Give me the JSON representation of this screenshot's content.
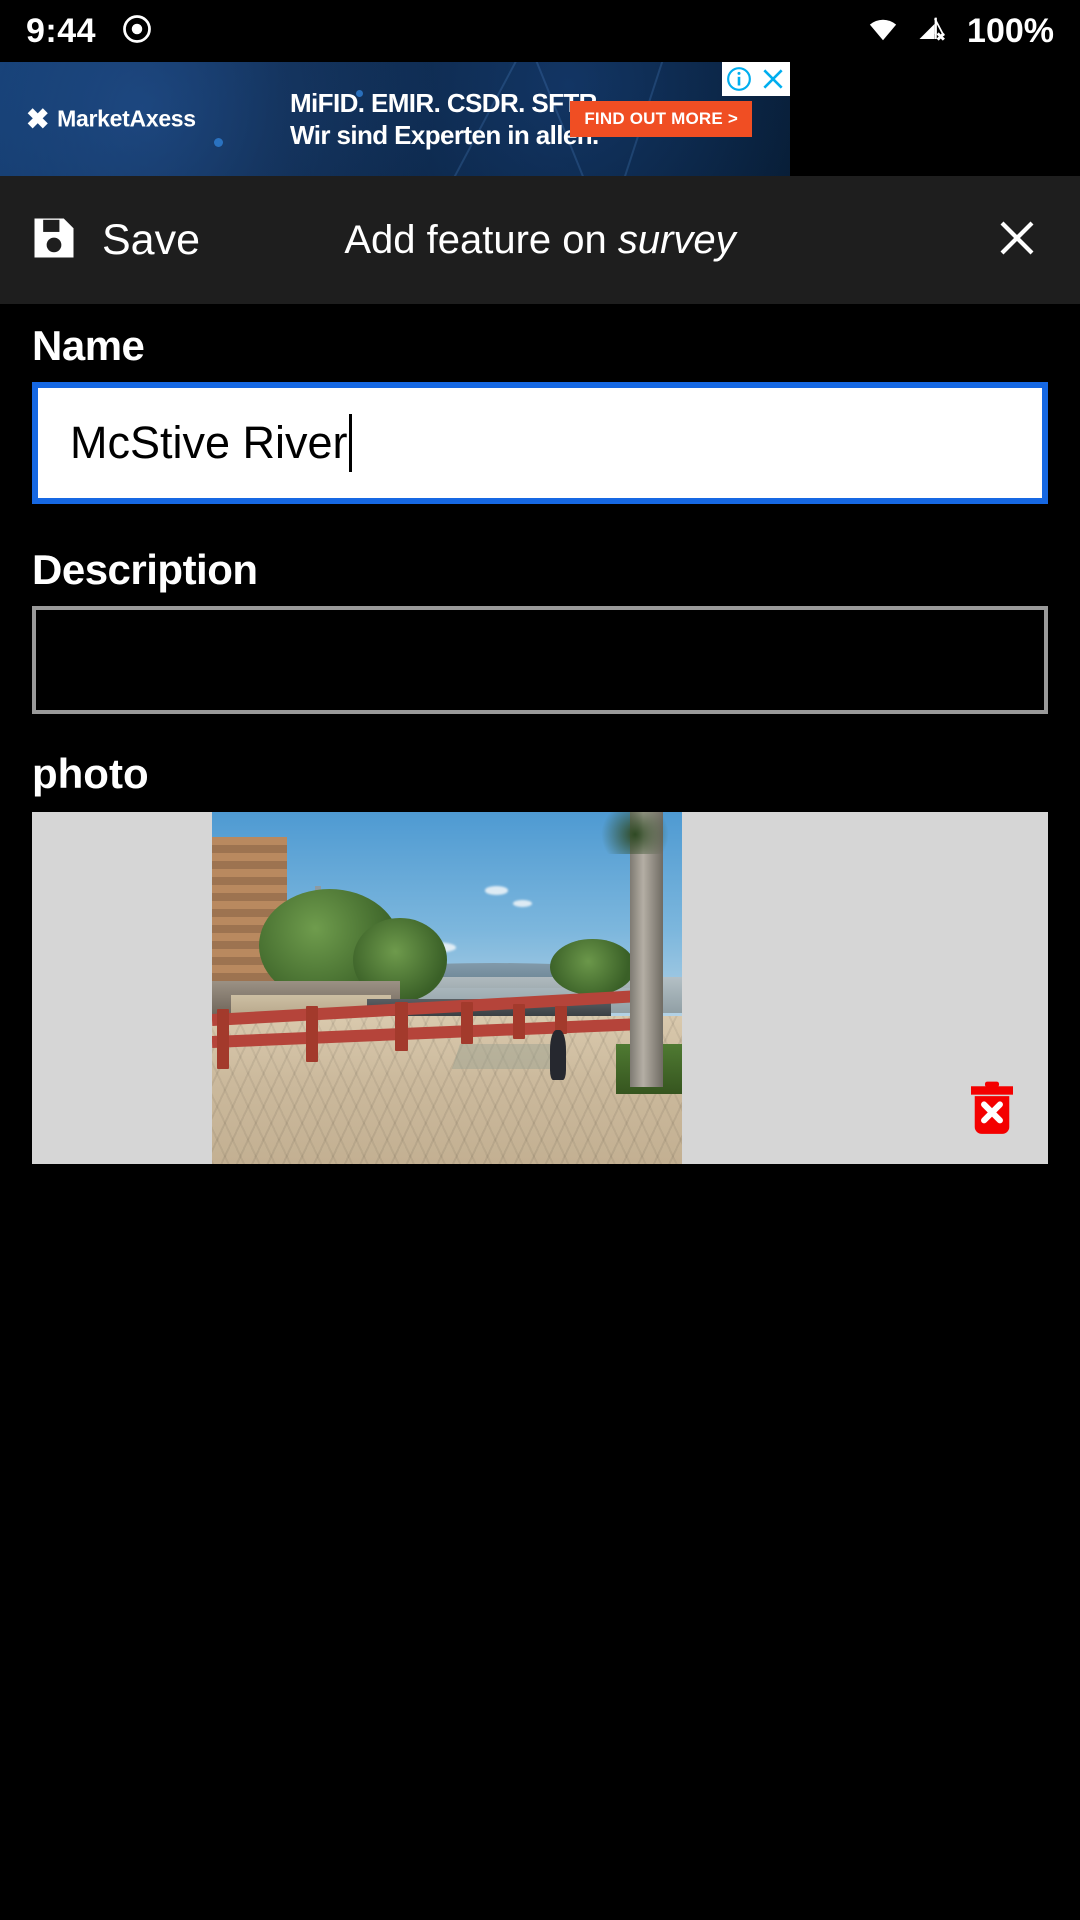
{
  "status_bar": {
    "time": "9:44",
    "battery": "100%",
    "icons": [
      "record-dot-icon",
      "wifi-icon",
      "cellular-no-signal-icon"
    ]
  },
  "ad": {
    "brand": "MarketAxess",
    "headline_line1": "MiFID. EMIR. CSDR. SFTR.",
    "headline_line2": "Wir sind Experten in allen.",
    "cta_label": "FIND OUT MORE  >",
    "cta_color": "#f04e23",
    "info_icon": "ad-info-icon",
    "close_icon": "ad-close-icon",
    "control_color": "#00aeef"
  },
  "toolbar": {
    "save_label": "Save",
    "save_icon": "floppy-disk-save-icon",
    "title_prefix": "Add feature on ",
    "title_layer": "survey",
    "close_icon": "close-icon",
    "background": "#1e1e1e"
  },
  "form": {
    "name": {
      "label": "Name",
      "value": "McStive River",
      "placeholder": "",
      "focused": true,
      "focus_border_color": "#1668e3"
    },
    "description": {
      "label": "Description",
      "value": "",
      "placeholder": "",
      "border_color": "#9a9a9a"
    },
    "photo": {
      "label": "photo",
      "delete_icon": "trash-delete-icon",
      "delete_color": "#f40000",
      "letterbox_color": "#d6d6d6",
      "alt": "riverside promenade with red railing, bridge and person walking"
    }
  }
}
